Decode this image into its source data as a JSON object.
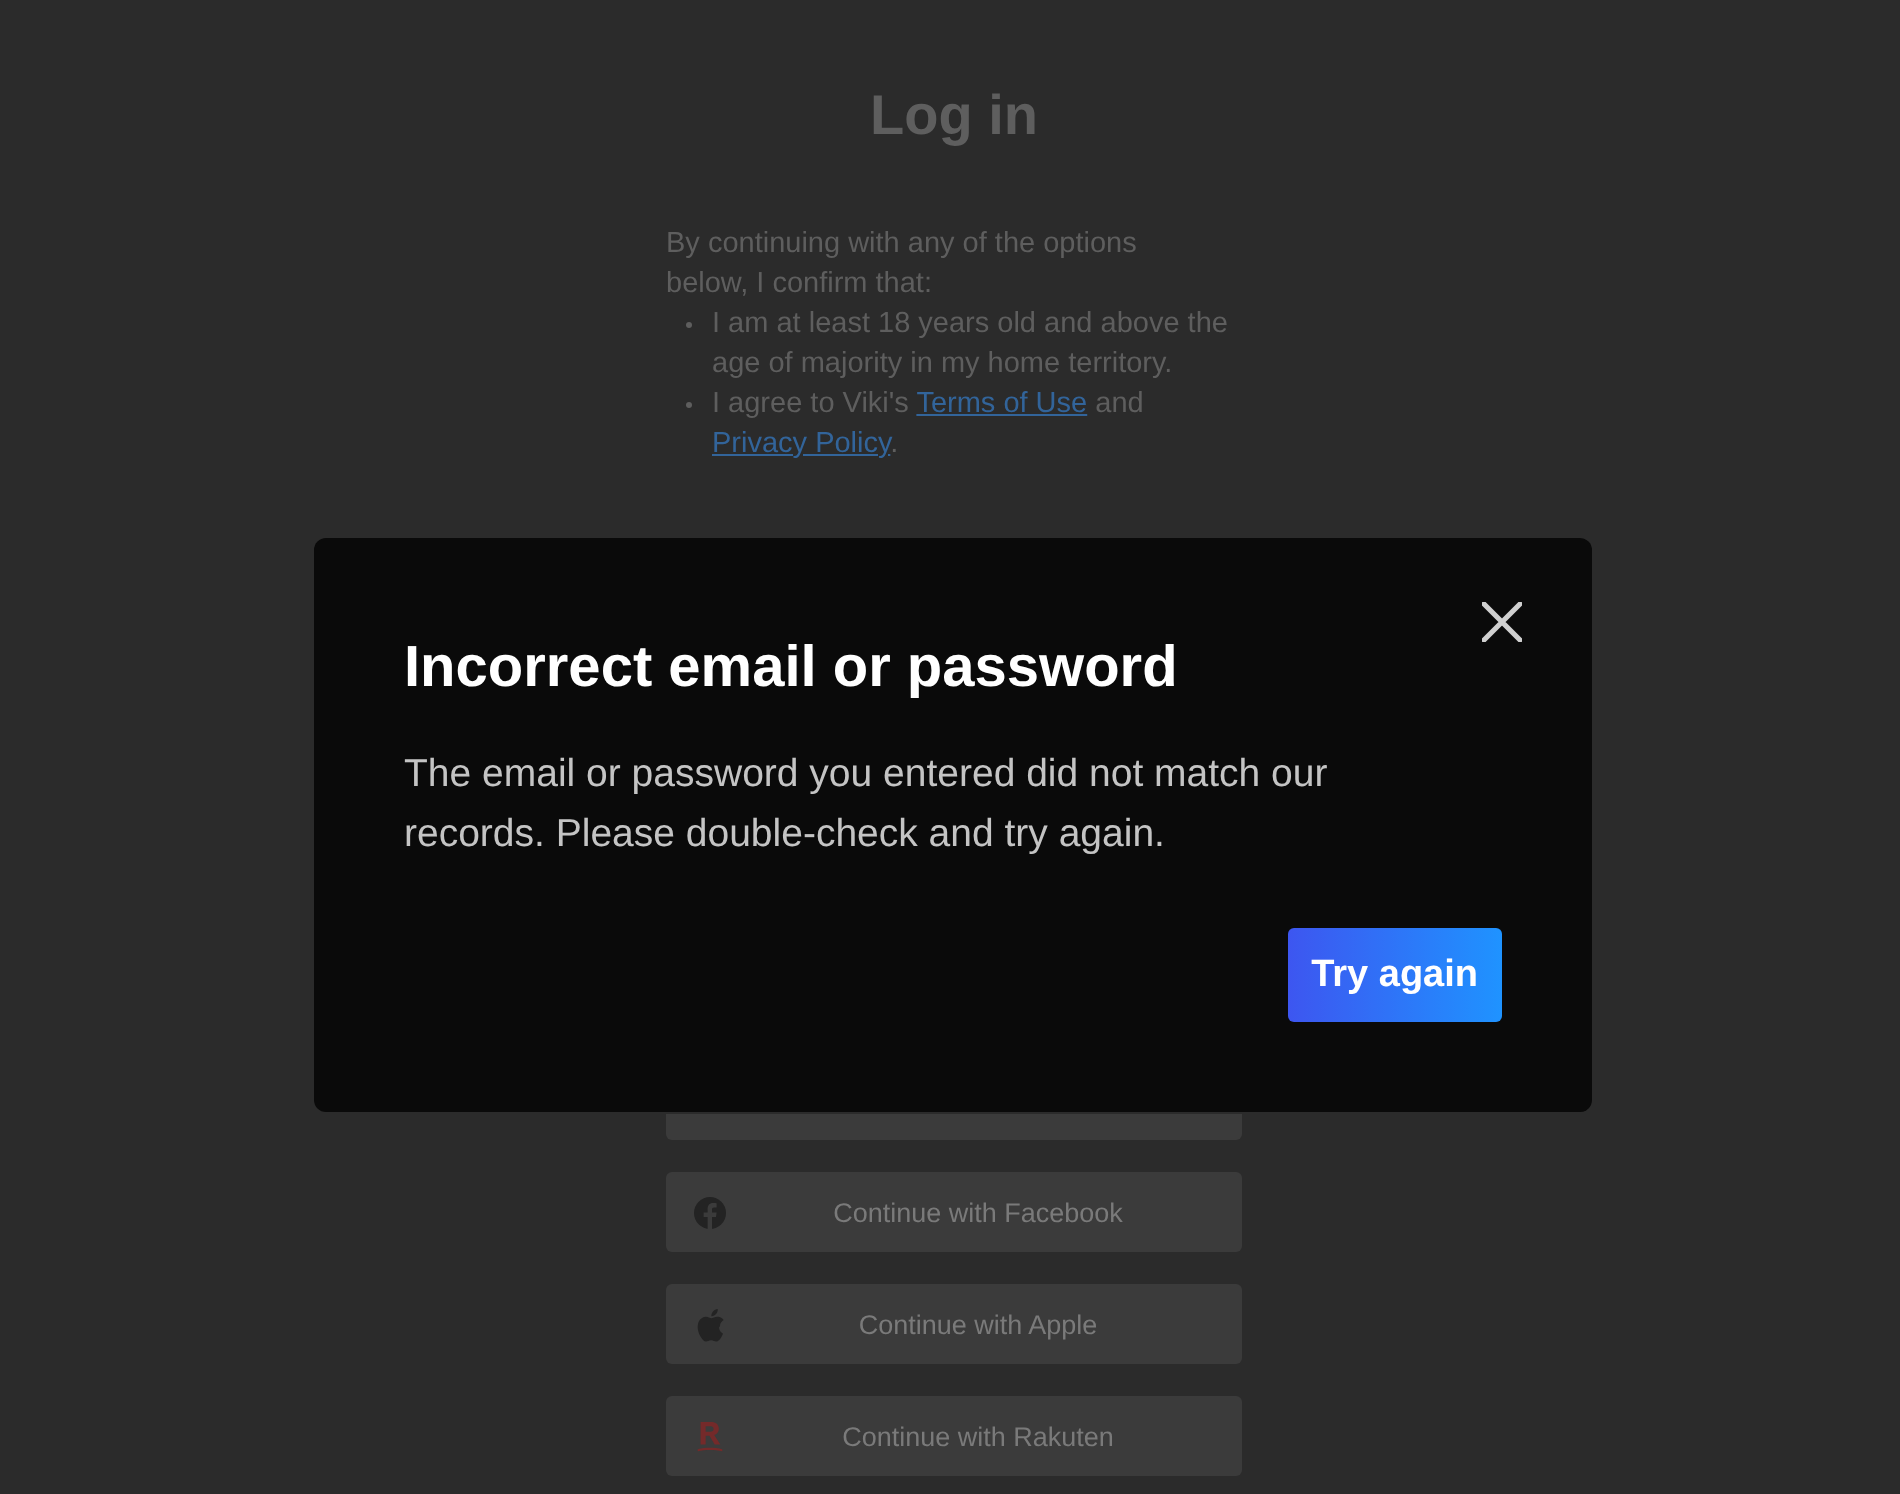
{
  "page": {
    "title": "Log in",
    "consent": {
      "intro": "By continuing with any of the options below, I confirm that:",
      "items": [
        [
          {
            "text": "I am at least 18 years old and above the age of majority in my home territory."
          }
        ],
        [
          {
            "text": "I agree to Viki's "
          },
          {
            "link": "Terms of Use"
          },
          {
            "text": " and "
          },
          {
            "link": "Privacy Policy"
          },
          {
            "text": "."
          }
        ]
      ]
    },
    "options": [
      {
        "kind": "covered"
      },
      {
        "kind": "facebook",
        "label": "Continue with Facebook"
      },
      {
        "kind": "apple",
        "label": "Continue with Apple"
      },
      {
        "kind": "rakuten",
        "label": "Continue with Rakuten"
      }
    ]
  },
  "dialog": {
    "title": "Incorrect email or password",
    "message": "The email or password you entered did not match our records. Please double-check and try again.",
    "button": "Try again"
  }
}
